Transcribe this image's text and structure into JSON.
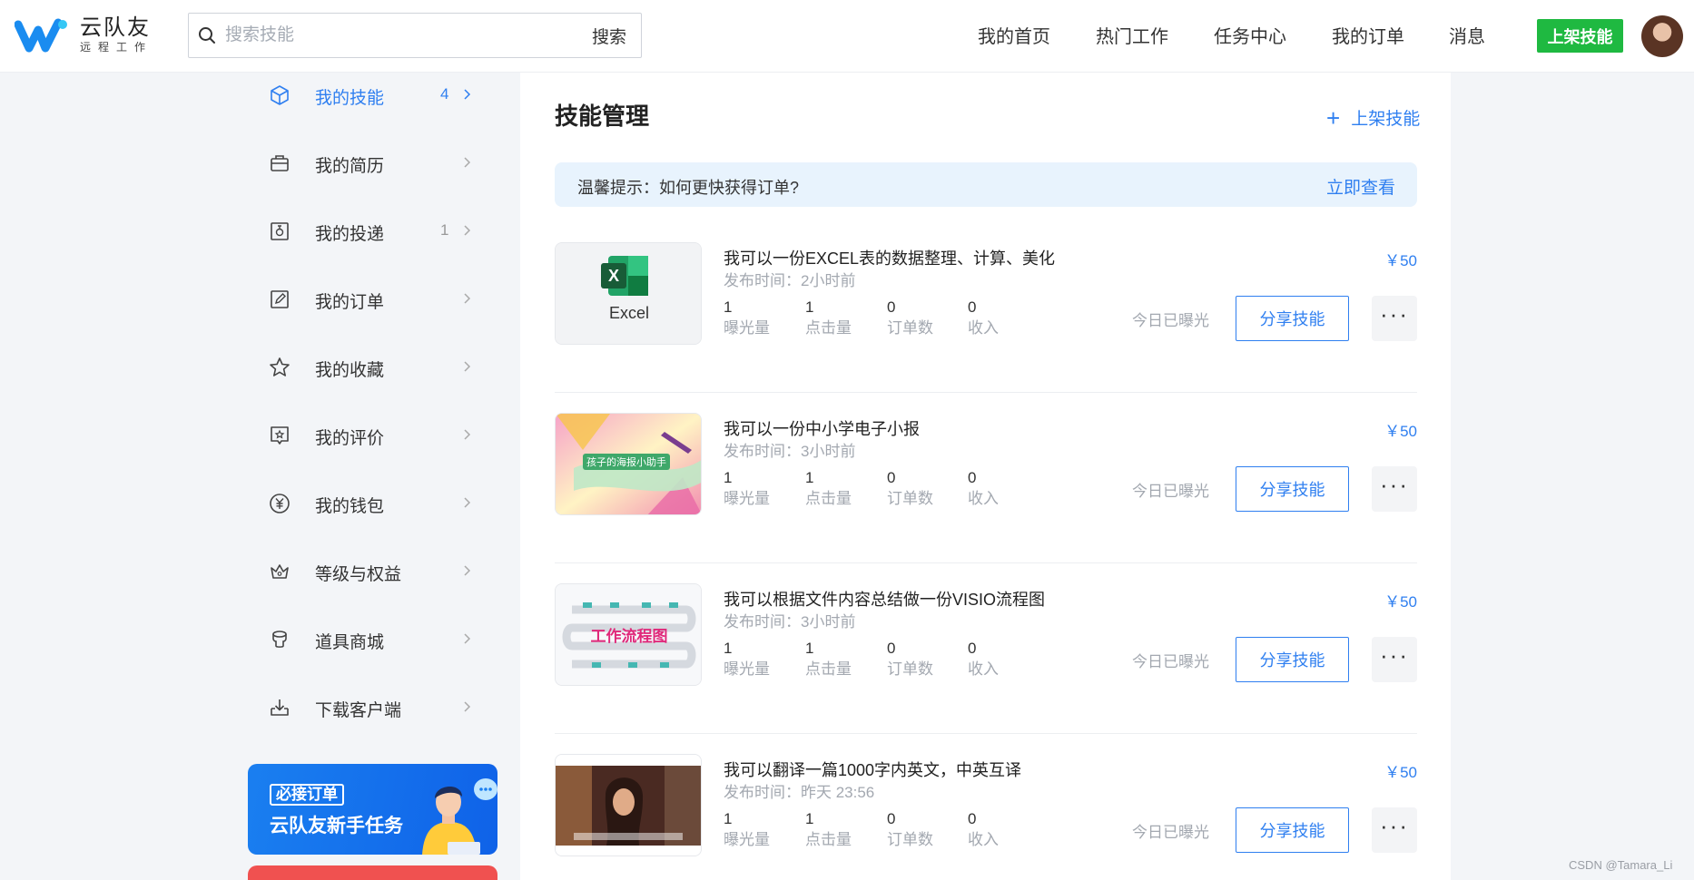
{
  "brand": {
    "name": "云队友",
    "tagline": "远程工作"
  },
  "search": {
    "placeholder": "搜索技能",
    "button_label": "搜索"
  },
  "nav": {
    "items": [
      "我的首页",
      "热门工作",
      "任务中心",
      "我的订单",
      "消息"
    ],
    "publish_label": "上架技能"
  },
  "sidebar": {
    "items": [
      {
        "label": "我的技能",
        "count": "4",
        "icon": "cube-icon",
        "active": true
      },
      {
        "label": "我的简历",
        "count": "",
        "icon": "briefcase-icon",
        "active": false
      },
      {
        "label": "我的投递",
        "count": "1",
        "icon": "delivery-icon",
        "active": false
      },
      {
        "label": "我的订单",
        "count": "",
        "icon": "edit-icon",
        "active": false
      },
      {
        "label": "我的收藏",
        "count": "",
        "icon": "star-icon",
        "active": false
      },
      {
        "label": "我的评价",
        "count": "",
        "icon": "review-icon",
        "active": false
      },
      {
        "label": "我的钱包",
        "count": "",
        "icon": "yen-icon",
        "active": false
      },
      {
        "label": "等级与权益",
        "count": "",
        "icon": "crown-icon",
        "active": false
      },
      {
        "label": "道具商城",
        "count": "",
        "icon": "shop-icon",
        "active": false
      },
      {
        "label": "下载客户端",
        "count": "",
        "icon": "download-icon",
        "active": false
      }
    ],
    "promo": {
      "tag": "必接订单",
      "title": "云队友新手任务"
    }
  },
  "main": {
    "title": "技能管理",
    "add_label": "上架技能",
    "tip": {
      "text": "温馨提示：如何更快获得订单?",
      "link": "立即查看"
    },
    "stat_labels": [
      "曝光量",
      "点击量",
      "订单数",
      "收入"
    ],
    "exposed_label": "今日已曝光",
    "share_label": "分享技能",
    "skills": [
      {
        "title": "我可以一份EXCEL表的数据整理、计算、美化",
        "time": "发布时间：2小时前",
        "price": "￥50",
        "stats": [
          "1",
          "1",
          "0",
          "0"
        ],
        "thumb": "excel",
        "thumb_text": "Excel"
      },
      {
        "title": "我可以一份中小学电子小报",
        "time": "发布时间：3小时前",
        "price": "￥50",
        "stats": [
          "1",
          "1",
          "0",
          "0"
        ],
        "thumb": "newspaper",
        "thumb_text": "孩子的海报小助手"
      },
      {
        "title": "我可以根据文件内容总结做一份VISIO流程图",
        "time": "发布时间：3小时前",
        "price": "￥50",
        "stats": [
          "1",
          "1",
          "0",
          "0"
        ],
        "thumb": "flowchart",
        "thumb_text": "工作流程图"
      },
      {
        "title": "我可以翻译一篇1000字内英文，中英互译",
        "time": "发布时间：昨天 23:56",
        "price": "￥50",
        "stats": [
          "1",
          "1",
          "0",
          "0"
        ],
        "thumb": "video",
        "thumb_text": ""
      }
    ]
  },
  "watermark": "CSDN @Tamara_Li",
  "colors": {
    "accent": "#2f7ff0",
    "publish": "#1fb941",
    "tip_bg": "#e8f3fd"
  }
}
